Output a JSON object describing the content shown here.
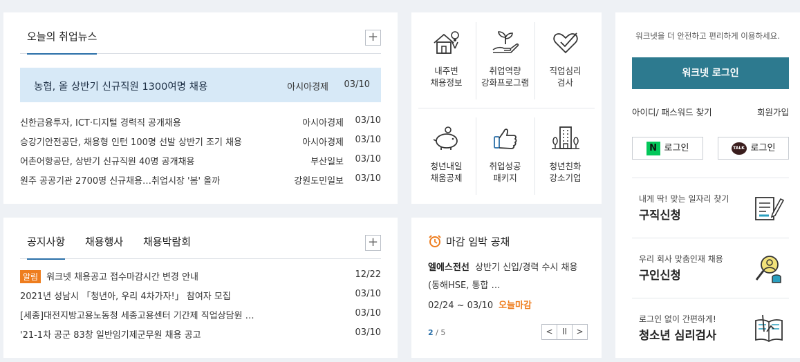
{
  "news": {
    "tab": "오늘의 취업뉴스",
    "more": "+",
    "headline": {
      "title": "농협, 올 상반기 신규직원 1300여명 채용",
      "source": "아시아경제",
      "date": "03/10"
    },
    "items": [
      {
        "title": "신한금융투자, ICT·디지털 경력직 공개채용",
        "source": "아시아경제",
        "date": "03/10"
      },
      {
        "title": "승강기안전공단, 채용형 인턴 100명 선발 상반기 조기 채용",
        "source": "아시아경제",
        "date": "03/10"
      },
      {
        "title": "어촌어항공단, 상반기 신규직원 40명 공개채용",
        "source": "부산일보",
        "date": "03/10"
      },
      {
        "title": "원주 공공기관 2700명 신규채용…취업시장 '봄' 올까",
        "source": "강원도민일보",
        "date": "03/10"
      }
    ]
  },
  "menu": {
    "items": [
      {
        "line1": "내주변",
        "line2": "채용정보",
        "icon": "house-location-icon"
      },
      {
        "line1": "취업역량",
        "line2": "강화프로그램",
        "icon": "sprout-hand-icon"
      },
      {
        "line1": "직업심리",
        "line2": "검사",
        "icon": "heart-check-icon"
      },
      {
        "line1": "청년내일",
        "line2": "채움공제",
        "icon": "piggy-bank-icon"
      },
      {
        "line1": "취업성공",
        "line2": "패키지",
        "icon": "thumbs-up-icon"
      },
      {
        "line1": "청년친화",
        "line2": "강소기업",
        "icon": "building-icon"
      }
    ]
  },
  "login": {
    "message": "워크넷을 더 안전하고 편리하게 이용하세요.",
    "button": "워크넷 로그인",
    "find": "아이디/ 패스워드 찾기",
    "join": "회원가입",
    "naver": {
      "mark": "N",
      "label": "로그인"
    },
    "kakao": {
      "mark": "TALK",
      "label": "로그인"
    },
    "services": [
      {
        "sub": "내게 딱! 맞는 일자리 찾기",
        "main": "구직신청"
      },
      {
        "sub": "우리 회사 맞춤인재 채용",
        "main": "구인신청"
      },
      {
        "sub": "로그인 없이 간편하게!",
        "main": "청소년 심리검사"
      }
    ]
  },
  "notice": {
    "tabs": [
      "공지사항",
      "채용행사",
      "채용박람회"
    ],
    "more": "+",
    "badge": "알림",
    "items": [
      {
        "title": "워크넷 채용공고 접수마감시간 변경 안내",
        "date": "12/22"
      },
      {
        "title": "2021년 성남시 「청년아, 우리 4차가자!」 참여자 모집",
        "date": "03/10"
      },
      {
        "title": "[세종]대전지방고용노동청 세종고용센터 기간제 직업상담원 …",
        "date": "03/10"
      },
      {
        "title": "'21-1차 공군 83창 일반임기제군무원 채용 공고",
        "date": "03/10"
      }
    ]
  },
  "deadline": {
    "title": "마감 임박 공채",
    "company": "엘에스전선",
    "desc": "상반기 신입/경력 수시 채용(동해HSE, 통합 …",
    "period": "02/24 ~ 03/10",
    "today": "오늘마감",
    "page_current": "2",
    "page_sep": " / ",
    "page_total": "5",
    "prev": "<",
    "pause": "II",
    "next": ">"
  },
  "colors": {
    "accent": "#2a6fa8",
    "login": "#2d7a8f",
    "highlight": "#d7e9f7",
    "orange": "#ee7d1e",
    "naver": "#03c75a"
  }
}
